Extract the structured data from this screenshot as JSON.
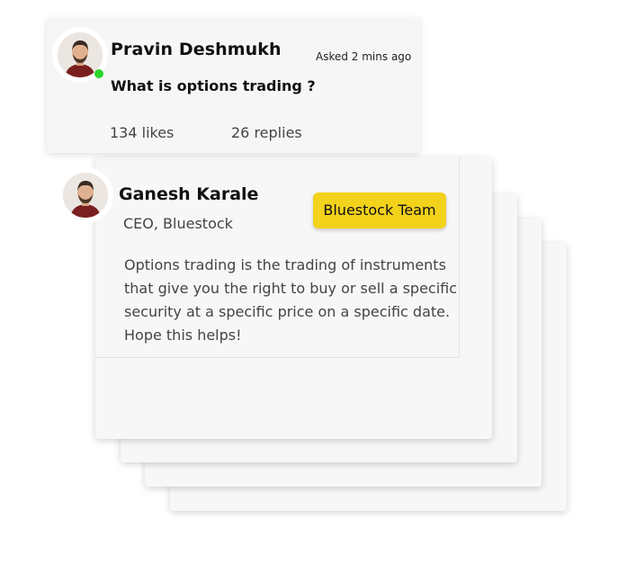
{
  "question": {
    "author": "Pravin Deshmukh",
    "time": "Asked 2 mins ago",
    "text": "What is options trading ?",
    "likes": "134 likes",
    "replies": "26 replies",
    "author_online": true
  },
  "answer": {
    "author": "Ganesh Karale",
    "role": "CEO, Bluestock",
    "badge": "Bluestock Team",
    "text": "Options trading is the trading of instruments that give you the right to buy or sell a specific security at a specific price on a specific date. Hope this helps!"
  },
  "colors": {
    "badge": "#f2d21b",
    "online": "#2bd62b",
    "card": "#f7f7f7"
  }
}
